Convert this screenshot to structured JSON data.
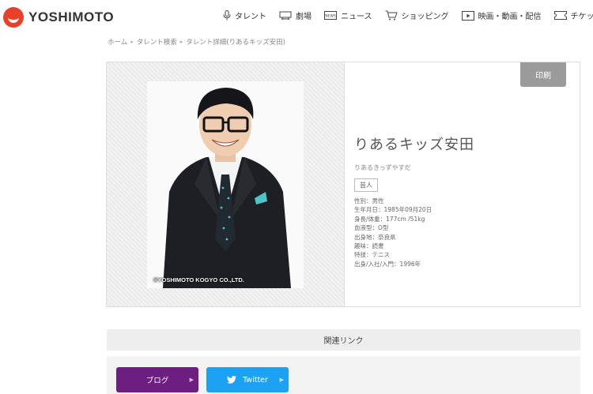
{
  "header": {
    "logo_text": "YOSHIMOTO",
    "nav": [
      {
        "label": "タレント",
        "icon": "microphone-icon"
      },
      {
        "label": "劇場",
        "icon": "theater-icon"
      },
      {
        "label": "ニュース",
        "icon": "news-icon"
      },
      {
        "label": "ショッピング",
        "icon": "cart-icon"
      },
      {
        "label": "映画・動画・配信",
        "icon": "video-icon"
      },
      {
        "label": "チケット販",
        "icon": "ticket-icon"
      }
    ]
  },
  "breadcrumb": [
    "ホーム",
    "タレント検索",
    "タレント詳細(りあるキッズ安田)"
  ],
  "profile": {
    "print_label": "印刷",
    "name": "りあるキッズ安田",
    "kana": "りあるきっずやすだ",
    "tag": "芸人",
    "details": [
      "性別：男性",
      "生年月日：1985年09月20日",
      "身長/体重：177cm /51kg",
      "血液型：O型",
      "出身地：奈良県",
      "趣味：読書",
      "特技：テニス",
      "出身/入社/入門：1996年"
    ],
    "photo_copyright": "©YOSHIMOTO KOGYO CO.,LTD."
  },
  "related": {
    "title": "関連リンク",
    "links": [
      {
        "label": "ブログ",
        "color": "#6e1e80"
      },
      {
        "label": "Twitter",
        "color": "#1da1f2",
        "icon": "twitter-bird-icon"
      }
    ]
  },
  "colors": {
    "brand": "#e8402a",
    "print_button": "#9b9b9b"
  }
}
